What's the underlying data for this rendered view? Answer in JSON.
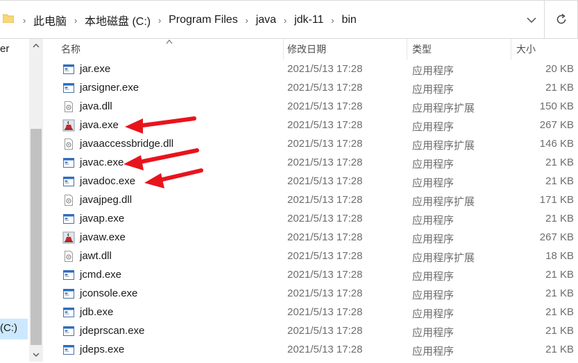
{
  "address_bar": {
    "breadcrumbs": [
      "此电脑",
      "本地磁盘 (C:)",
      "Program Files",
      "java",
      "jdk-11",
      "bin"
    ]
  },
  "nav": {
    "partial_item_top": "er",
    "partial_item_drive": "(C:)"
  },
  "columns": {
    "name": "名称",
    "date": "修改日期",
    "type": "类型",
    "size": "大小"
  },
  "files": [
    {
      "name": "jar.exe",
      "date": "2021/5/13 17:28",
      "type": "应用程序",
      "size": "20 KB",
      "icon": "exe-window-icon"
    },
    {
      "name": "jarsigner.exe",
      "date": "2021/5/13 17:28",
      "type": "应用程序",
      "size": "21 KB",
      "icon": "exe-window-icon"
    },
    {
      "name": "java.dll",
      "date": "2021/5/13 17:28",
      "type": "应用程序扩展",
      "size": "150 KB",
      "icon": "dll-gear-icon"
    },
    {
      "name": "java.exe",
      "date": "2021/5/13 17:28",
      "type": "应用程序",
      "size": "267 KB",
      "icon": "java-cup-icon"
    },
    {
      "name": "javaaccessbridge.dll",
      "date": "2021/5/13 17:28",
      "type": "应用程序扩展",
      "size": "146 KB",
      "icon": "dll-gear-icon"
    },
    {
      "name": "javac.exe",
      "date": "2021/5/13 17:28",
      "type": "应用程序",
      "size": "21 KB",
      "icon": "exe-window-icon"
    },
    {
      "name": "javadoc.exe",
      "date": "2021/5/13 17:28",
      "type": "应用程序",
      "size": "21 KB",
      "icon": "exe-window-icon"
    },
    {
      "name": "javajpeg.dll",
      "date": "2021/5/13 17:28",
      "type": "应用程序扩展",
      "size": "171 KB",
      "icon": "dll-gear-icon"
    },
    {
      "name": "javap.exe",
      "date": "2021/5/13 17:28",
      "type": "应用程序",
      "size": "21 KB",
      "icon": "exe-window-icon"
    },
    {
      "name": "javaw.exe",
      "date": "2021/5/13 17:28",
      "type": "应用程序",
      "size": "267 KB",
      "icon": "java-cup-icon"
    },
    {
      "name": "jawt.dll",
      "date": "2021/5/13 17:28",
      "type": "应用程序扩展",
      "size": "18 KB",
      "icon": "dll-gear-icon"
    },
    {
      "name": "jcmd.exe",
      "date": "2021/5/13 17:28",
      "type": "应用程序",
      "size": "21 KB",
      "icon": "exe-window-icon"
    },
    {
      "name": "jconsole.exe",
      "date": "2021/5/13 17:28",
      "type": "应用程序",
      "size": "21 KB",
      "icon": "exe-window-icon"
    },
    {
      "name": "jdb.exe",
      "date": "2021/5/13 17:28",
      "type": "应用程序",
      "size": "21 KB",
      "icon": "exe-window-icon"
    },
    {
      "name": "jdeprscan.exe",
      "date": "2021/5/13 17:28",
      "type": "应用程序",
      "size": "21 KB",
      "icon": "exe-window-icon"
    },
    {
      "name": "jdeps.exe",
      "date": "2021/5/13 17:28",
      "type": "应用程序",
      "size": "21 KB",
      "icon": "exe-window-icon"
    }
  ],
  "annotations": {
    "arrow_color": "#e8141c",
    "arrows_point_to": [
      "java.exe",
      "javac.exe",
      "javadoc.exe"
    ]
  },
  "colors": {
    "selection": "#cce8ff",
    "folder": "#f8d775"
  }
}
